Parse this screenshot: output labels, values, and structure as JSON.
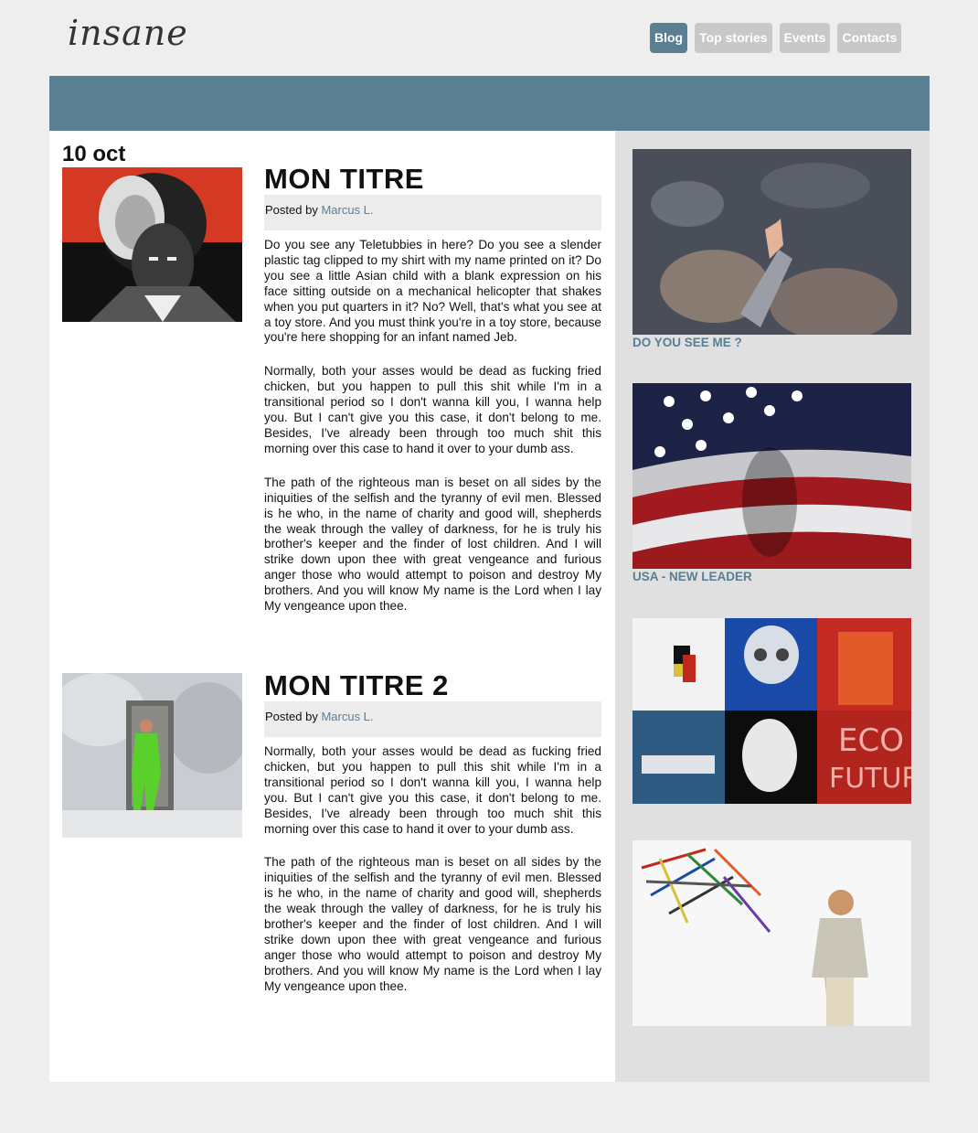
{
  "header": {
    "logo": "insane",
    "nav": [
      {
        "label": "Blog",
        "active": true
      },
      {
        "label": "Top stories",
        "active": false
      },
      {
        "label": "Events",
        "active": false
      },
      {
        "label": "Contacts",
        "active": false
      }
    ]
  },
  "colors": {
    "accent": "#5a7f92",
    "nav_inactive": "#c8c8c8",
    "sidebar_bg": "#e0e0e0"
  },
  "main": {
    "date": "10 oct",
    "posts": [
      {
        "title": "MON TITRE",
        "posted_prefix": "Posted by",
        "author": "Marcus L.",
        "paragraphs": [
          "Do you see any Teletubbies in here? Do you see a slender plastic tag clipped to my shirt with my name printed on it? Do you see a little Asian child with a blank expression on his face sitting outside on a mechanical helicopter that shakes when you put quarters in it? No? Well, that's what you see at a toy store. And you must think you're in a toy store, because you're here shopping for an infant named Jeb.",
          "Normally, both your asses would be dead as fucking fried chicken, but you happen to pull this shit while I'm in a transitional period so I don't wanna kill you, I wanna help you. But I can't give you this case, it don't belong to me. Besides, I've already been through too much shit this morning over this case to hand it over to your dumb ass.",
          "The path of the righteous man is beset on all sides by the iniquities of the selfish and the tyranny of evil men. Blessed is he who, in the name of charity and good will, shepherds the weak through the valley of darkness, for he is truly his brother's keeper and the finder of lost children. And I will strike down upon thee with great vengeance and furious anger those who would attempt to poison and destroy My brothers. And you will know My name is the Lord when I lay My vengeance upon thee."
        ]
      },
      {
        "title": "MON TITRE 2",
        "posted_prefix": "Posted by",
        "author": "Marcus L.",
        "paragraphs": [
          "Normally, both your asses would be dead as fucking fried chicken, but you happen to pull this shit while I'm in a transitional period so I don't wanna kill you, I wanna help you. But I can't give you this case, it don't belong to me. Besides, I've already been through too much shit this morning over this case to hand it over to your dumb ass.",
          "The path of the righteous man is beset on all sides by the iniquities of the selfish and the tyranny of evil men. Blessed is he who, in the name of charity and good will, shepherds the weak through the valley of darkness, for he is truly his brother's keeper and the finder of lost children. And I will strike down upon thee with great vengeance and furious anger those who would attempt to poison and destroy My brothers. And you will know My name is the Lord when I lay My vengeance upon thee."
        ]
      }
    ]
  },
  "sidebar": {
    "items": [
      {
        "caption": "DO YOU SEE ME ?"
      },
      {
        "caption": "USA - NEW LEADER"
      },
      {
        "caption": ""
      },
      {
        "caption": ""
      }
    ]
  }
}
